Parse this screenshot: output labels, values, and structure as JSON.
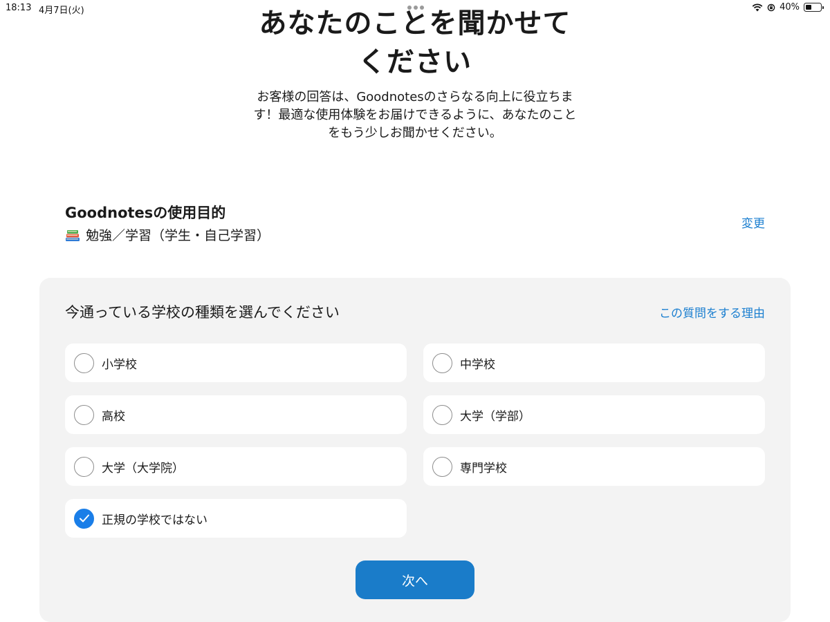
{
  "status_bar": {
    "time": "18:13",
    "date": "4月7日(火)",
    "battery_percent": "40%",
    "battery_level": 0.4,
    "icons": [
      "wifi-icon",
      "orientation-lock-icon",
      "battery-icon"
    ]
  },
  "header": {
    "title_line1": "あなたのことを聞かせて",
    "title_line2": "ください",
    "subtitle_line1": "お客様の回答は、Goodnotesのさらなる向上に役立ちま",
    "subtitle_line2": "す！最適な使用体験をお届けできるように、あなたのこと",
    "subtitle_line3": "をもう少しお聞かせください。"
  },
  "purpose": {
    "heading": "Goodnotesの使用目的",
    "value": "勉強／学習（学生・自己学習）",
    "icon": "books-icon",
    "change_label": "変更"
  },
  "question": {
    "title": "今通っている学校の種類を選んでください",
    "why_label": "この質問をする理由",
    "options": [
      {
        "label": "小学校",
        "checked": false
      },
      {
        "label": "中学校",
        "checked": false
      },
      {
        "label": "高校",
        "checked": false
      },
      {
        "label": "大学（学部）",
        "checked": false
      },
      {
        "label": "大学（大学院）",
        "checked": false
      },
      {
        "label": "専門学校",
        "checked": false
      },
      {
        "label": "正規の学校ではない",
        "checked": true
      }
    ],
    "next_label": "次へ"
  },
  "colors": {
    "accent": "#1a7ee8",
    "link": "#1b7fd0",
    "button": "#1a7cc9",
    "card_background": "#f3f3f3"
  }
}
